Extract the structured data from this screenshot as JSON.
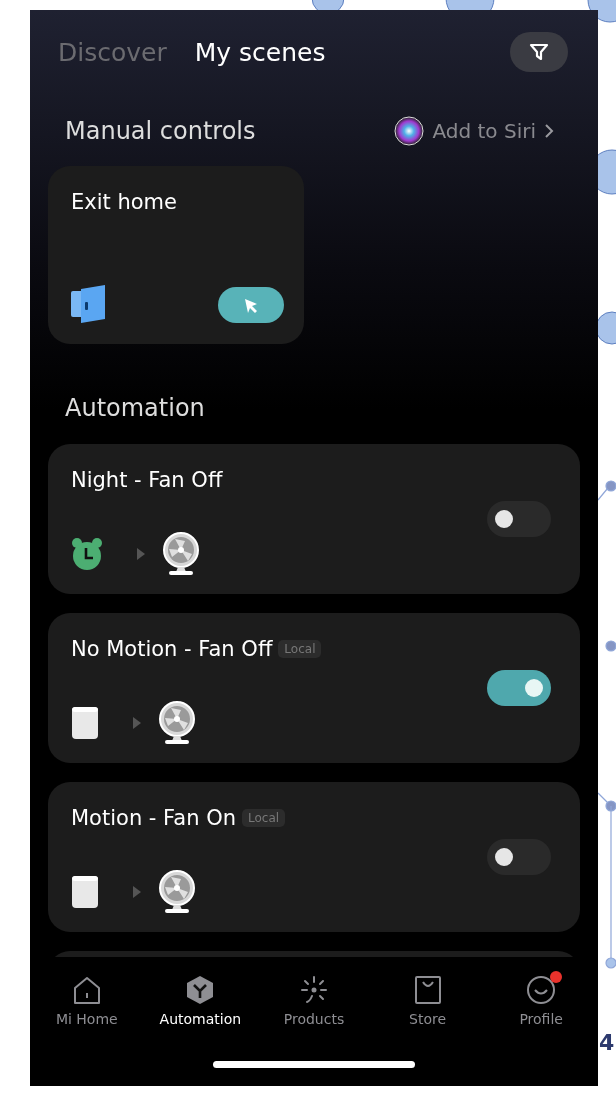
{
  "header": {
    "tabs": [
      {
        "label": "Discover",
        "selected": false
      },
      {
        "label": "My scenes",
        "selected": true
      }
    ]
  },
  "manual_controls": {
    "title": "Manual controls",
    "siri_link": "Add to Siri",
    "scenes": [
      {
        "name": "Exit home"
      }
    ]
  },
  "automation": {
    "title": "Automation",
    "scenes": [
      {
        "name": "Night - Fan Off",
        "kind": "timer",
        "on": false
      },
      {
        "name": "No Motion - Fan Off",
        "badge": "Local",
        "kind": "motion",
        "on": true
      },
      {
        "name": "Motion - Fan On",
        "badge": "Local",
        "kind": "motion",
        "on": false
      },
      {
        "kind": "hidden"
      }
    ]
  },
  "tab_bar": {
    "items": [
      {
        "label": "Mi Home",
        "selected": false,
        "notification": false
      },
      {
        "label": "Automation",
        "selected": true,
        "notification": false
      },
      {
        "label": "Products",
        "selected": false,
        "notification": false
      },
      {
        "label": "Store",
        "selected": false,
        "notification": false
      },
      {
        "label": "Profile",
        "selected": false,
        "notification": true
      }
    ]
  },
  "backdrop_text": "4"
}
